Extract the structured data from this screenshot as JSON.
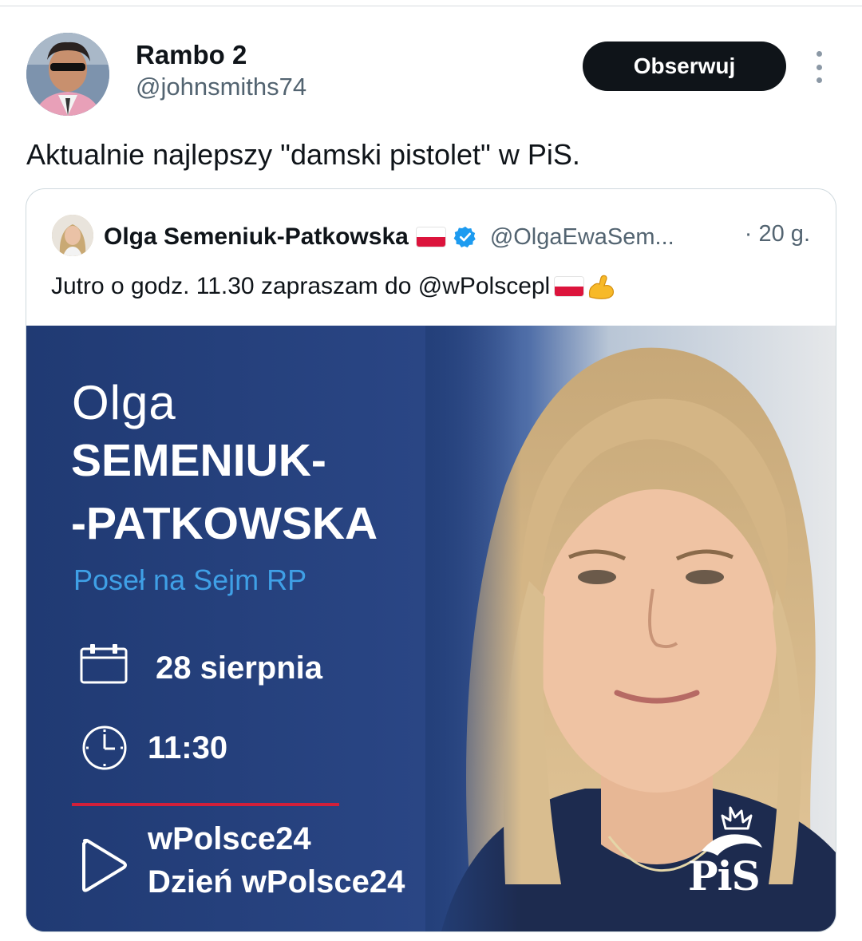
{
  "tweet": {
    "author": {
      "display_name": "Rambo 2",
      "handle": "@johnsmiths74"
    },
    "follow_label": "Obserwuj",
    "text": "Aktualnie najlepszy \"damski pistolet\" w PiS."
  },
  "quoted_tweet": {
    "author": {
      "display_name": "Olga Semeniuk-Patkowska",
      "handle": "@OlgaEwaSem...",
      "verified": true
    },
    "time": "· 20 g.",
    "text": "Jutro o godz. 11.30 zapraszam do @wPolscepl",
    "media": {
      "first_name": "Olga",
      "last_name_line1": "SEMENIUK-",
      "last_name_line2": "-PATKOWSKA",
      "role": "Poseł na Sejm RP",
      "date": "28 sierpnia",
      "time": "11:30",
      "channel_line1": "wPolsce24",
      "channel_line2": "Dzień wPolsce24",
      "logo_text": "PiS"
    }
  },
  "colors": {
    "follow_bg": "#0f1419",
    "media_blue": "#24407a",
    "role_blue": "#3fa0e6",
    "accent_red": "#d1203a",
    "verified_blue": "#1d9bf0",
    "secondary_text": "#536471"
  },
  "icons": {
    "more": "more-vertical-icon",
    "verified": "verified-badge-icon",
    "flag": "poland-flag-icon",
    "muscle": "flexed-biceps-icon",
    "calendar": "calendar-icon",
    "clock": "clock-icon",
    "play": "play-icon"
  }
}
